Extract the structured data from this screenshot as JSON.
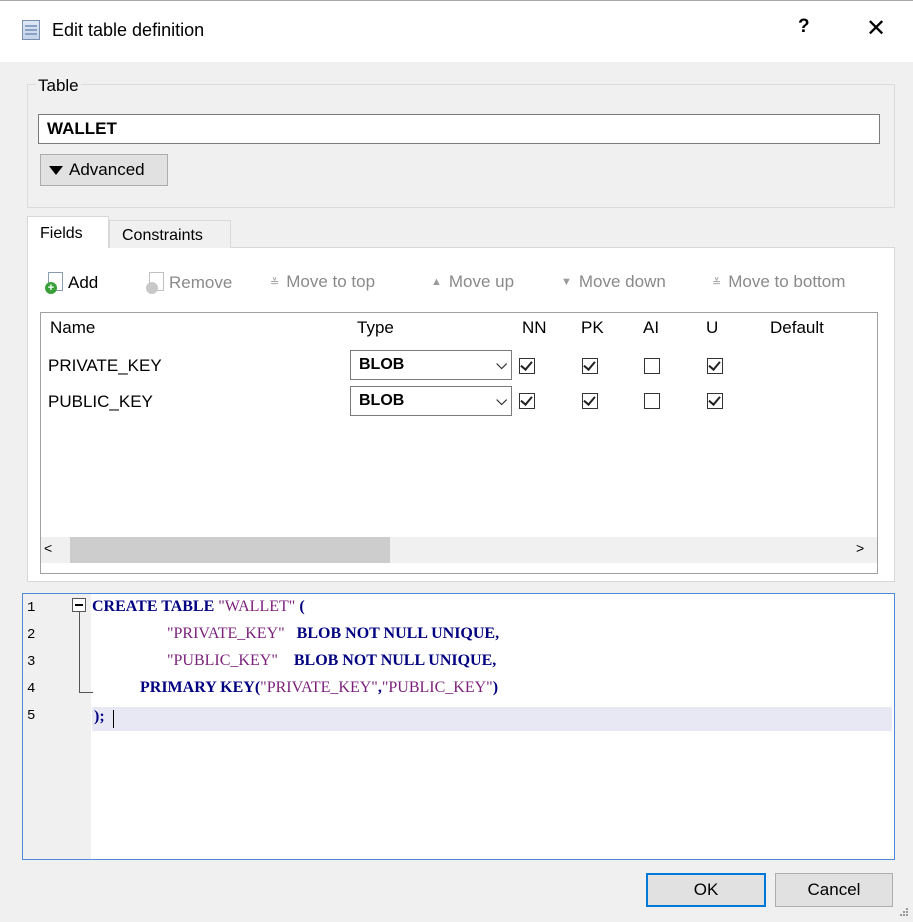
{
  "window": {
    "title": "Edit table definition",
    "help_label": "?",
    "close_label": "✕"
  },
  "table_group": {
    "label": "Table",
    "name_value": "WALLET",
    "advanced_label": "Advanced"
  },
  "tabs": [
    {
      "label": "Fields"
    },
    {
      "label": "Constraints"
    }
  ],
  "toolbar": {
    "add_label": "Add",
    "remove_label": "Remove",
    "move_top_label": "Move to top",
    "move_up_label": "Move up",
    "move_down_label": "Move down",
    "move_bottom_label": "Move to bottom"
  },
  "grid": {
    "columns": [
      "Name",
      "Type",
      "NN",
      "PK",
      "AI",
      "U",
      "Default"
    ],
    "rows": [
      {
        "name": "PRIVATE_KEY",
        "type": "BLOB",
        "nn": true,
        "pk": true,
        "ai": false,
        "u": true
      },
      {
        "name": "PUBLIC_KEY",
        "type": "BLOB",
        "nn": true,
        "pk": true,
        "ai": false,
        "u": true
      }
    ]
  },
  "scrollbar": {
    "left_arrow": "<",
    "right_arrow": ">"
  },
  "editor": {
    "line_numbers": [
      "1",
      "2",
      "3",
      "4",
      "5"
    ],
    "lines": [
      [
        {
          "t": "CREATE TABLE ",
          "c": "kw"
        },
        {
          "t": "\"WALLET\"",
          "c": "str"
        },
        {
          "t": " (",
          "c": "kw"
        }
      ],
      [
        {
          "t": "\"PRIVATE_KEY\"",
          "c": "str"
        },
        {
          "t": "   BLOB NOT NULL UNIQUE,",
          "c": "kw"
        }
      ],
      [
        {
          "t": "\"PUBLIC_KEY\"",
          "c": "str"
        },
        {
          "t": "    BLOB NOT NULL UNIQUE,",
          "c": "kw"
        }
      ],
      [
        {
          "t": "PRIMARY KEY(",
          "c": "kw"
        },
        {
          "t": "\"PRIVATE_KEY\"",
          "c": "str"
        },
        {
          "t": ",",
          "c": "kw"
        },
        {
          "t": "\"PUBLIC_KEY\"",
          "c": "str"
        },
        {
          "t": ")",
          "c": "kw"
        }
      ],
      [
        {
          "t": ");",
          "c": "kw"
        }
      ]
    ]
  },
  "footer": {
    "ok_label": "OK",
    "cancel_label": "Cancel"
  }
}
